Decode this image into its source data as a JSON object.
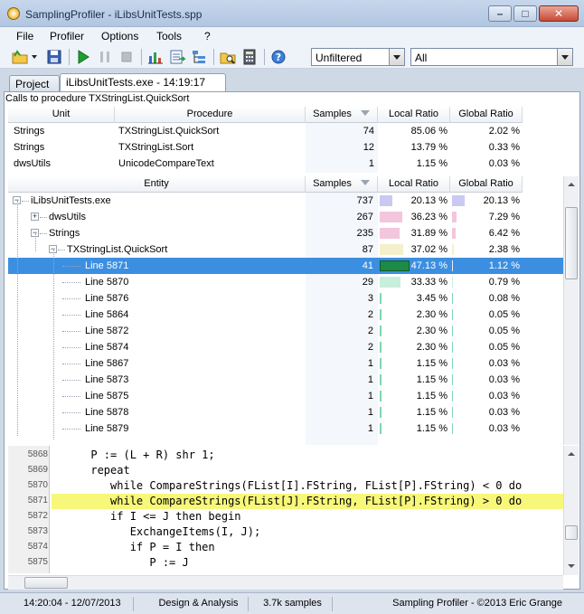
{
  "window": {
    "title": "SamplingProfiler - iLibsUnitTests.spp"
  },
  "menu": [
    "File",
    "Profiler",
    "Options",
    "Tools",
    "?"
  ],
  "toolbar": {
    "icons": [
      "open-folder-icon",
      "dropdown-arrow-icon",
      "save-icon",
      "run-icon",
      "pause-icon",
      "stop-icon",
      "chart-icon",
      "export-icon",
      "tree-icon",
      "folder-search-icon",
      "calculator-icon",
      "help-icon"
    ],
    "filter1": "Unfiltered",
    "filter2": "All"
  },
  "tabs": [
    {
      "label": "Project",
      "active": false
    },
    {
      "label": "iLibsUnitTests.exe - 14:19:17",
      "active": true
    }
  ],
  "calls": {
    "caption": "Calls to procedure TXStringList.QuickSort",
    "columns": [
      "Unit",
      "Procedure",
      "Samples",
      "Local Ratio",
      "Global Ratio"
    ],
    "rows": [
      {
        "unit": "Strings",
        "procedure": "TXStringList.QuickSort",
        "samples": "74",
        "local": "85.06 %",
        "global": "2.02 %"
      },
      {
        "unit": "Strings",
        "procedure": "TXStringList.Sort",
        "samples": "12",
        "local": "13.79 %",
        "global": "0.33 %"
      },
      {
        "unit": "dwsUtils",
        "procedure": "UnicodeCompareText",
        "samples": "1",
        "local": "1.15 %",
        "global": "0.03 %"
      }
    ]
  },
  "tree": {
    "columns": [
      "Entity",
      "Samples",
      "Local Ratio",
      "Global Ratio"
    ],
    "rows": [
      {
        "name": "iLibsUnitTests.exe",
        "depth": 0,
        "expander": "-",
        "samples": "737",
        "local": "20.13 %",
        "global": "20.13 %",
        "local_pct": 20.13,
        "global_pct": 20.13,
        "bar_color": "#c9c9f2",
        "selected": false
      },
      {
        "name": "dwsUtils",
        "depth": 1,
        "expander": "+",
        "samples": "267",
        "local": "36.23 %",
        "global": "7.29 %",
        "local_pct": 36.23,
        "global_pct": 7.29,
        "bar_color": "#f2c6dc",
        "selected": false
      },
      {
        "name": "Strings",
        "depth": 1,
        "expander": "-",
        "samples": "235",
        "local": "31.89 %",
        "global": "6.42 %",
        "local_pct": 31.89,
        "global_pct": 6.42,
        "bar_color": "#f2c6dc",
        "selected": false
      },
      {
        "name": "TXStringList.QuickSort",
        "depth": 2,
        "expander": "-",
        "samples": "87",
        "local": "37.02 %",
        "global": "2.38 %",
        "local_pct": 37.02,
        "global_pct": 2.38,
        "bar_color": "#f4f0cc",
        "selected": false
      },
      {
        "name": "Line 5871",
        "depth": 3,
        "expander": "",
        "samples": "41",
        "local": "47.13 %",
        "global": "1.12 %",
        "local_pct": 47.13,
        "global_pct": 1.12,
        "bar_color": "#1e8a48",
        "selected": true
      },
      {
        "name": "Line 5870",
        "depth": 3,
        "expander": "",
        "samples": "29",
        "local": "33.33 %",
        "global": "0.79 %",
        "local_pct": 33.33,
        "global_pct": 0.79,
        "bar_color": "#c8eedc",
        "selected": false
      },
      {
        "name": "Line 5876",
        "depth": 3,
        "expander": "",
        "samples": "3",
        "local": "3.45 %",
        "global": "0.08 %",
        "local_pct": 3.45,
        "global_pct": 0.08,
        "bar_color": "#7fd6b0",
        "selected": false
      },
      {
        "name": "Line 5864",
        "depth": 3,
        "expander": "",
        "samples": "2",
        "local": "2.30 %",
        "global": "0.05 %",
        "local_pct": 2.3,
        "global_pct": 0.05,
        "bar_color": "#7fd6b0",
        "selected": false
      },
      {
        "name": "Line 5872",
        "depth": 3,
        "expander": "",
        "samples": "2",
        "local": "2.30 %",
        "global": "0.05 %",
        "local_pct": 2.3,
        "global_pct": 0.05,
        "bar_color": "#7fd6b0",
        "selected": false
      },
      {
        "name": "Line 5874",
        "depth": 3,
        "expander": "",
        "samples": "2",
        "local": "2.30 %",
        "global": "0.05 %",
        "local_pct": 2.3,
        "global_pct": 0.05,
        "bar_color": "#7fd6b0",
        "selected": false
      },
      {
        "name": "Line 5867",
        "depth": 3,
        "expander": "",
        "samples": "1",
        "local": "1.15 %",
        "global": "0.03 %",
        "local_pct": 1.15,
        "global_pct": 0.03,
        "bar_color": "#7fd6b0",
        "selected": false
      },
      {
        "name": "Line 5873",
        "depth": 3,
        "expander": "",
        "samples": "1",
        "local": "1.15 %",
        "global": "0.03 %",
        "local_pct": 1.15,
        "global_pct": 0.03,
        "bar_color": "#7fd6b0",
        "selected": false
      },
      {
        "name": "Line 5875",
        "depth": 3,
        "expander": "",
        "samples": "1",
        "local": "1.15 %",
        "global": "0.03 %",
        "local_pct": 1.15,
        "global_pct": 0.03,
        "bar_color": "#7fd6b0",
        "selected": false
      },
      {
        "name": "Line 5878",
        "depth": 3,
        "expander": "",
        "samples": "1",
        "local": "1.15 %",
        "global": "0.03 %",
        "local_pct": 1.15,
        "global_pct": 0.03,
        "bar_color": "#7fd6b0",
        "selected": false
      },
      {
        "name": "Line 5879",
        "depth": 3,
        "expander": "",
        "samples": "1",
        "local": "1.15 %",
        "global": "0.03 %",
        "local_pct": 1.15,
        "global_pct": 0.03,
        "bar_color": "#7fd6b0",
        "selected": false
      }
    ]
  },
  "code": {
    "lines": [
      {
        "no": "5868",
        "text": "      P := (L + R) shr 1;",
        "highlight": false
      },
      {
        "no": "5869",
        "text": "      repeat",
        "highlight": false
      },
      {
        "no": "5870",
        "text": "         while CompareStrings(FList[I].FString, FList[P].FString) < 0 do",
        "highlight": false
      },
      {
        "no": "5871",
        "text": "         while CompareStrings(FList[J].FString, FList[P].FString) > 0 do",
        "highlight": true
      },
      {
        "no": "5872",
        "text": "         if I <= J then begin",
        "highlight": false
      },
      {
        "no": "5873",
        "text": "            ExchangeItems(I, J);",
        "highlight": false
      },
      {
        "no": "5874",
        "text": "            if P = I then",
        "highlight": false
      },
      {
        "no": "5875",
        "text": "               P := J",
        "highlight": false
      }
    ]
  },
  "status": {
    "datetime": "14:20:04 - 12/07/2013",
    "mode": "Design & Analysis",
    "samples": "3.7k samples",
    "copyright": "Sampling Profiler - ©2013 Eric Grange"
  },
  "colors": {
    "selection": "#3c8fe0",
    "highlight_line": "#f7f77a",
    "local_bar_scale": "#c9c9f2"
  }
}
